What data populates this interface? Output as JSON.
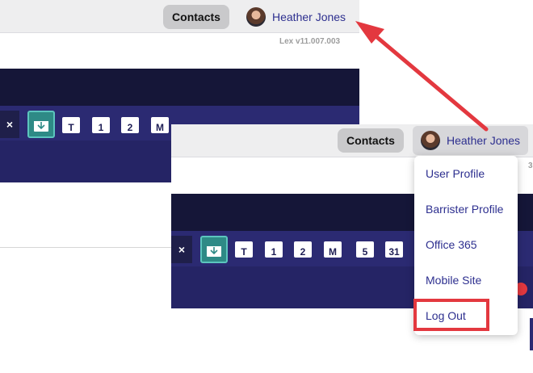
{
  "back": {
    "contacts_label": "Contacts",
    "user_name": "Heather Jones",
    "version": "Lex v11.007.003",
    "close_glyph": "×",
    "toolbar_tiles": [
      "T",
      "1",
      "2",
      "M"
    ]
  },
  "front": {
    "contacts_label": "Contacts",
    "user_name": "Heather Jones",
    "version_tail": "3",
    "close_glyph": "×",
    "toolbar_tiles": [
      "T",
      "1",
      "2",
      "M",
      "5",
      "31"
    ],
    "menu": {
      "items": [
        "User Profile",
        "Barrister Profile",
        "Office 365",
        "Mobile Site",
        "Log Out"
      ]
    }
  },
  "annotation": {
    "color": "#e3383f"
  }
}
